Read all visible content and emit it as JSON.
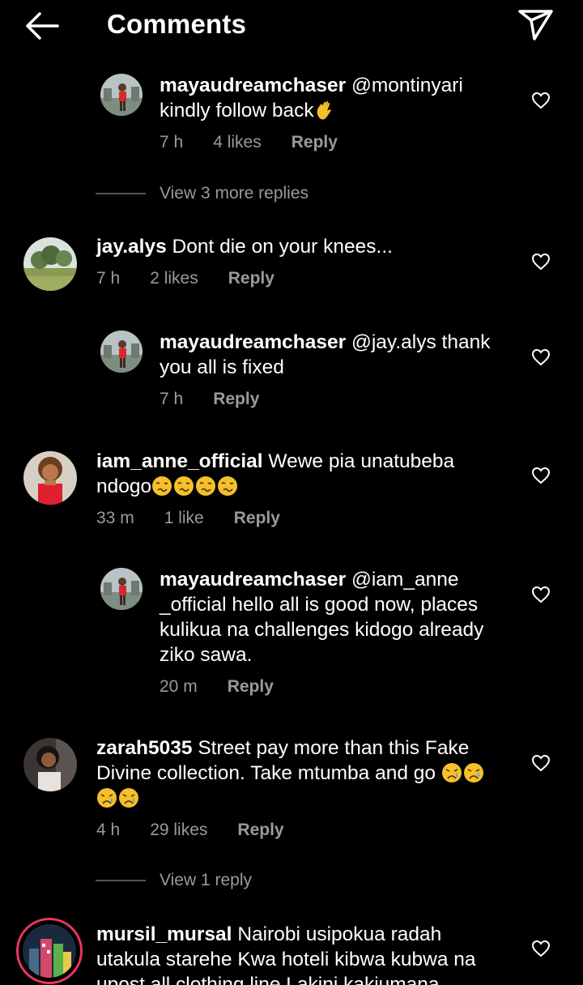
{
  "header": {
    "title": "Comments",
    "back_icon": "arrow-left-icon",
    "send_icon": "paper-plane-icon"
  },
  "comments": [
    {
      "username": "mayaudreamchaser",
      "text": "@montinyari kindly follow back",
      "emoji": "waving-hand-icon",
      "time": "7 h",
      "likes": "4 likes",
      "reply": "Reply"
    },
    {
      "view_replies": "View 3 more replies"
    },
    {
      "username": "jay.alys",
      "text": "Dont die on your knees...",
      "time": "7 h",
      "likes": "2 likes",
      "reply": "Reply"
    },
    {
      "username": "mayaudreamchaser",
      "text": "@jay.alys thank you all is fixed",
      "time": "7 h",
      "reply": "Reply"
    },
    {
      "username": "iam_anne_official",
      "text": "Wewe pia unatubeba ndogo",
      "emoji": "woozy-face-icon",
      "time": "33 m",
      "likes": "1 like",
      "reply": "Reply"
    },
    {
      "username": "mayaudreamchaser",
      "text": "@iam_anne _official hello all is good now, places kulikua na challenges kidogo already ziko sawa.",
      "time": "20 m",
      "reply": "Reply"
    },
    {
      "username": "zarah5035",
      "text": "Street pay more than this Fake Divine collection. Take mtumba and go",
      "emoji": "crying-face-icon",
      "time": "4 h",
      "likes": "29 likes",
      "reply": "Reply"
    },
    {
      "view_replies": "View 1 reply"
    },
    {
      "username": "mursil_mursal",
      "text": "Nairobi usipokua radah utakula starehe  Kwa hoteli kibwa kubwa na upost all clothing line Lakini kakiumana"
    }
  ]
}
